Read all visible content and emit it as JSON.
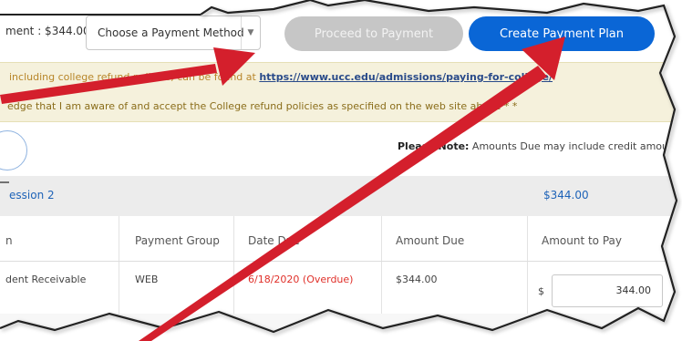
{
  "topbar": {
    "amount_label": "ment : $344.00",
    "payment_method_select": "Choose a Payment Method",
    "proceed_button": "Proceed to Payment",
    "create_plan_button": "Create Payment Plan"
  },
  "notice": {
    "line1_prefix": "including college refund policies, can be found at ",
    "line1_link": "https://www.ucc.edu/admissions/paying-for-college/",
    "line2": "edge that I am aware of and accept the College refund policies as specified on the web site above * *"
  },
  "please_note": {
    "label": "Please Note:",
    "text": " Amounts Due may include credit amoun"
  },
  "session": {
    "title": "ession 2",
    "amount": "$344.00"
  },
  "table": {
    "headers": [
      "n",
      "Payment Group",
      "Date Due",
      "Amount Due",
      "Amount to Pay"
    ],
    "rows": [
      {
        "description": "dent Receivable",
        "group": "WEB",
        "date_due": "6/18/2020 (Overdue)",
        "amount_due": "$344.00",
        "currency": "$",
        "amount_to_pay": "344.00"
      }
    ]
  },
  "colors": {
    "primary_button": "#0a66d6",
    "disabled_button": "#c6c6c6",
    "notice_bg": "#f5f1dc",
    "overdue": "#e0302a",
    "annotation_arrow": "#d41f2c"
  },
  "icons": {
    "select_chevron": "chevron-down-icon",
    "annotation": "red-arrow-icon"
  }
}
